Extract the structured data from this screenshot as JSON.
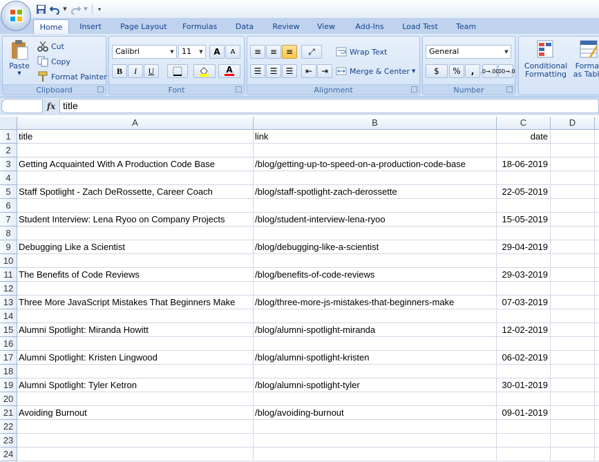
{
  "quick_access": {
    "save_icon": "save-icon",
    "undo_icon": "undo-icon",
    "redo_icon": "redo-icon"
  },
  "tabs": [
    "Home",
    "Insert",
    "Page Layout",
    "Formulas",
    "Data",
    "Review",
    "View",
    "Add-Ins",
    "Load Test",
    "Team"
  ],
  "active_tab": "Home",
  "ribbon": {
    "clipboard": {
      "label": "Clipboard",
      "paste": "Paste",
      "cut": "Cut",
      "copy": "Copy",
      "format_painter": "Format Painter"
    },
    "font": {
      "label": "Font",
      "font_name": "Calibri",
      "font_size": "11",
      "bold": "B",
      "italic": "I",
      "underline": "U",
      "grow": "A",
      "shrink": "A",
      "font_color_letter": "A"
    },
    "alignment": {
      "label": "Alignment",
      "wrap_text": "Wrap Text",
      "merge_center": "Merge & Center"
    },
    "number": {
      "label": "Number",
      "format": "General",
      "currency": "$",
      "percent": "%",
      "comma": ",",
      "inc_decimal": ".0→.00",
      "dec_decimal": ".00→.0"
    },
    "styles": {
      "conditional": "Conditional",
      "formatting": "Formatting",
      "format": "Format",
      "as_table": "as Table"
    }
  },
  "formula_bar": {
    "fx": "fx",
    "content": "title"
  },
  "columns": [
    "A",
    "B",
    "C",
    "D"
  ],
  "rows": [
    [
      "title",
      "link",
      "date"
    ],
    [
      "",
      "",
      ""
    ],
    [
      "Getting Acquainted With A Production Code Base",
      "/blog/getting-up-to-speed-on-a-production-code-base",
      "18-06-2019"
    ],
    [
      "",
      "",
      ""
    ],
    [
      "Staff Spotlight - Zach DeRossette, Career Coach",
      "/blog/staff-spotlight-zach-derossette",
      "22-05-2019"
    ],
    [
      "",
      "",
      ""
    ],
    [
      "Student Interview: Lena Ryoo on Company Projects",
      "/blog/student-interview-lena-ryoo",
      "15-05-2019"
    ],
    [
      "",
      "",
      ""
    ],
    [
      "Debugging Like a Scientist",
      "/blog/debugging-like-a-scientist",
      "29-04-2019"
    ],
    [
      "",
      "",
      ""
    ],
    [
      "The Benefits of Code Reviews",
      "/blog/benefits-of-code-reviews",
      "29-03-2019"
    ],
    [
      "",
      "",
      ""
    ],
    [
      "Three More JavaScript Mistakes That Beginners Make",
      "/blog/three-more-js-mistakes-that-beginners-make",
      "07-03-2019"
    ],
    [
      "",
      "",
      ""
    ],
    [
      "Alumni Spotlight: Miranda Howitt",
      "/blog/alumni-spotlight-miranda",
      "12-02-2019"
    ],
    [
      "",
      "",
      ""
    ],
    [
      "Alumni Spotlight: Kristen Lingwood",
      "/blog/alumni-spotlight-kristen",
      "06-02-2019"
    ],
    [
      "",
      "",
      ""
    ],
    [
      "Alumni Spotlight: Tyler Ketron",
      "/blog/alumni-spotlight-tyler",
      "30-01-2019"
    ],
    [
      "",
      "",
      ""
    ],
    [
      "Avoiding Burnout",
      "/blog/avoiding-burnout",
      "09-01-2019"
    ],
    [
      "",
      "",
      ""
    ],
    [
      "",
      "",
      ""
    ],
    [
      "",
      "",
      ""
    ]
  ]
}
